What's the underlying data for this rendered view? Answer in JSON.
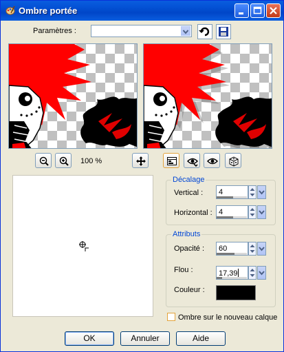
{
  "window": {
    "title": "Ombre portée"
  },
  "params": {
    "label": "Paramètres :",
    "value": ""
  },
  "zoom": {
    "level": "100 %"
  },
  "offset": {
    "legend": "Décalage",
    "vertical": {
      "label": "Vertical :",
      "value": "4"
    },
    "horizontal": {
      "label": "Horizontal :",
      "value": "4"
    }
  },
  "attrs": {
    "legend": "Attributs",
    "opacity": {
      "label": "Opacité :",
      "value": "60"
    },
    "blur": {
      "label": "Flou :",
      "value": "17,39"
    },
    "color": {
      "label": "Couleur :",
      "value": "#000000"
    }
  },
  "new_layer": {
    "label": "Ombre sur le nouveau calque",
    "checked": false
  },
  "buttons": {
    "ok": "OK",
    "cancel": "Annuler",
    "help": "Aide"
  },
  "colors": {
    "title_bar": "#0a5ddf",
    "dialog_bg": "#ece9d8",
    "legend_text": "#0046d5",
    "accent_red": "#ff0000"
  }
}
